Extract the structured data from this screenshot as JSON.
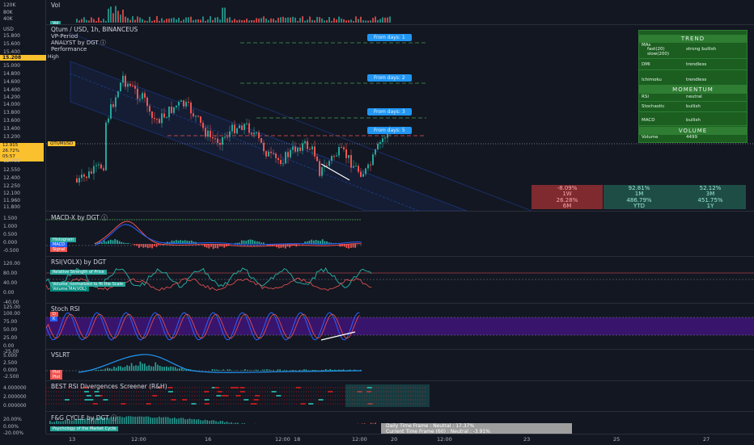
{
  "panes": {
    "vol": {
      "title": "Vol",
      "ticks": [
        "120K",
        "80K",
        "40K"
      ]
    },
    "price": {
      "symbol_line": "Qtum / USD, 1h, BINANCEUS",
      "indicators": [
        "VP-Period",
        "ANALYST by DGT ⓘ",
        "Performance"
      ],
      "ticks": [
        "15.800",
        "15.600",
        "15.400",
        "15.208",
        "15.000",
        "14.800",
        "14.600",
        "14.400",
        "14.200",
        "14.000",
        "13.800",
        "13.600",
        "13.400",
        "13.200",
        "13.000",
        "12.849",
        "12.700",
        "12.550",
        "12.400",
        "12.250",
        "12.100",
        "11.960",
        "11.800",
        "11.640"
      ],
      "currency": "USD ",
      "current_price": "12.915",
      "price_tag_sub": "26.72%",
      "price_tag_time": "05:57",
      "high_label": "High",
      "symbol_tag": "QTUMUSD",
      "fib_labels": [
        "From days: 1",
        "From days: 2",
        "From days: 3",
        "From days: 5"
      ],
      "trend_panel": {
        "trend_header": "TREND",
        "rows": [
          {
            "k": "MAs",
            "v": ""
          },
          {
            "k": "fast(20)",
            "v": "strong bullish"
          },
          {
            "k": "slow(200)",
            "v": ""
          },
          {
            "k": "DMI",
            "v": "trendless"
          },
          {
            "k": "Ichimoku",
            "v": "trendless"
          }
        ],
        "momentum_header": "MOMENTUM",
        "mom_rows": [
          {
            "k": "RSI",
            "v": "neutral"
          },
          {
            "k": "Stochastic",
            "v": "bullish"
          },
          {
            "k": "MACD",
            "v": "bullish"
          }
        ],
        "volume_header": "VOLUME",
        "vol_row": {
          "k": "Volume",
          "v": "4499"
        }
      },
      "performance": [
        {
          "value": "-8.09%",
          "period": "1W",
          "color": "#7f2a2e",
          "text": "#f7a8ab"
        },
        {
          "value": "92.81%",
          "period": "1M",
          "color": "#1e4d45",
          "text": "#9be7d5"
        },
        {
          "value": "52.12%",
          "period": "3M",
          "color": "#1e4d45",
          "text": "#9be7d5"
        },
        {
          "value": "26.28%",
          "period": "6M",
          "color": "#7f2a2e",
          "text": "#f7a8ab"
        },
        {
          "value": "486.79%",
          "period": "YTD",
          "color": "#1e4d45",
          "text": "#9be7d5"
        },
        {
          "value": "451.75%",
          "period": "1Y",
          "color": "#1e4d45",
          "text": "#9be7d5"
        }
      ]
    },
    "macd": {
      "title": "MACD-X by DGT ⓘ",
      "ticks": [
        "1.500",
        "1.000",
        "0.500",
        "0.000",
        "-0.500"
      ],
      "chips": [
        "Histogram",
        "MACD",
        "Signal"
      ]
    },
    "rsivolx": {
      "title": "RSI(VOLX) by DGT",
      "ticks": [
        "120.00",
        "80.00",
        "40.00",
        "0.00",
        "-40.00"
      ],
      "chips": [
        "Relative Strength of Price",
        "Volume_normalized to fit the Scale",
        "Volume MA(VOL)"
      ]
    },
    "stoch": {
      "title": "Stoch RSI",
      "ticks": [
        "125.00",
        "100.00",
        "75.00",
        "50.00",
        "25.00",
        "0.00",
        "-25.00"
      ]
    },
    "vslrt": {
      "title": "VSLRT",
      "ticks": [
        "5.000",
        "2.500",
        "0.000",
        "-2.500"
      ],
      "chips": [
        "Plot",
        "Plot"
      ]
    },
    "bestrsi": {
      "title": "BEST RSI Divergences Screener (R&H)",
      "ticks": [
        "4.000000",
        "2.000000",
        "0.000000"
      ]
    },
    "fg": {
      "title": "F&G CYCLE by DGT ⓘ",
      "ticks": [
        "20.00%",
        "0.00%",
        "-20.00%"
      ],
      "chip": "Psychology of the Market Cycle",
      "info_line1": "Daily Time Frame : Neutral : 17.37%",
      "info_line2": "Current Time Frame (60) : Neutral : -3.91%"
    }
  },
  "xaxis": [
    "13",
    "12:00",
    "16",
    "12:00",
    "18",
    "12:00",
    "20",
    "12:00",
    "23",
    "25",
    "27"
  ],
  "colors": {
    "bg": "#131722",
    "up": "#26a69a",
    "down": "#ef5350",
    "channel": "#2962ff",
    "stoch_band": "#4a148c"
  }
}
